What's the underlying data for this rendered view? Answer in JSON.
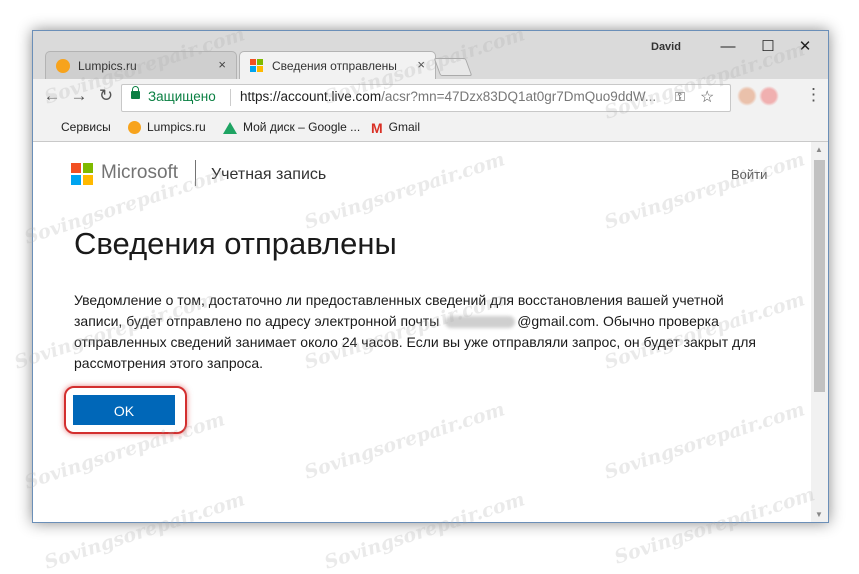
{
  "window": {
    "user": "David",
    "controls": {
      "minimize": "—",
      "maximize": "☐",
      "close": "✕"
    }
  },
  "tabs": [
    {
      "title": "Lumpics.ru",
      "close": "×"
    },
    {
      "title": "Сведения отправлены",
      "close": "×"
    }
  ],
  "toolbar": {
    "back": "←",
    "forward": "→",
    "reload": "↻",
    "secure_label": "Защищено",
    "url_host": "https://account.live.com",
    "url_rest": "/acsr?mn=47Dzx83DQ1at0gr7DmQuo9ddW...",
    "key": "⚿",
    "star": "☆",
    "menu": "⋮"
  },
  "bookmarks": [
    {
      "label": "Сервисы",
      "icon": "apps-grid-icon"
    },
    {
      "label": "Lumpics.ru",
      "icon": "orange-icon"
    },
    {
      "label": "Мой диск – Google ...",
      "icon": "google-drive-icon"
    },
    {
      "label": "Gmail",
      "icon": "gmail-icon"
    }
  ],
  "page": {
    "brand": "Microsoft",
    "section": "Учетная запись",
    "signin": "Войти",
    "title": "Сведения отправлены",
    "message_part1": "Уведомление о том, достаточно ли предоставленных сведений для восстановления вашей учетной записи, будет отправлено по адресу электронной почты",
    "message_email_domain": "@gmail.com",
    "message_part2": ". Обычно проверка отправленных сведений занимает около 24 часов. Если вы уже отправляли запрос, он будет закрыт для рассмотрения этого запроса.",
    "ok_label": "OK"
  },
  "watermark": "Sovingsorepair.com",
  "colors": {
    "ms_red": "#f25022",
    "ms_green": "#7fba00",
    "ms_blue": "#00a4ef",
    "ms_yellow": "#ffb900",
    "ok_button": "#0067b8",
    "highlight": "#d32f2f",
    "secure": "#0b8043"
  }
}
